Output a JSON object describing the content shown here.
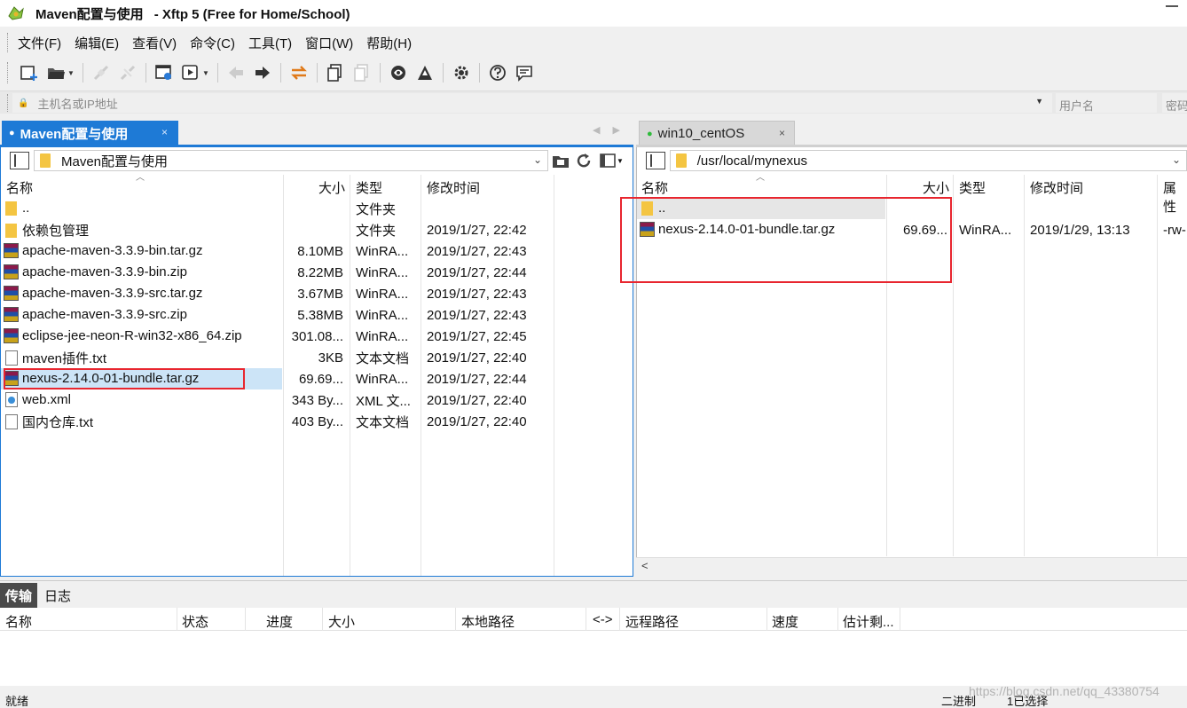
{
  "window": {
    "title_app": "Maven配置与使用",
    "title_suffix": "- Xftp 5 (Free for Home/School)"
  },
  "menu": [
    "文件(F)",
    "编辑(E)",
    "查看(V)",
    "命令(C)",
    "工具(T)",
    "窗口(W)",
    "帮助(H)"
  ],
  "toolbar": {
    "icons": [
      "new-session-icon",
      "open-folder-icon",
      "connect-icon",
      "disconnect-icon",
      "properties-icon",
      "transfer-icon",
      "back-arrow-icon",
      "forward-arrow-icon",
      "sync-icon",
      "copy-icon",
      "paste-icon",
      "xshell-icon",
      "xmanager-icon",
      "settings-icon",
      "help-icon",
      "chat-icon"
    ]
  },
  "address": {
    "host_placeholder": "主机名或IP地址",
    "user_placeholder": "用户名",
    "password_placeholder": "密码"
  },
  "left": {
    "tab_label": "Maven配置与使用",
    "path": "Maven配置与使用",
    "headers": {
      "name": "名称",
      "size": "大小",
      "type": "类型",
      "modified": "修改时间"
    },
    "files": [
      {
        "icon": "folder",
        "name": "..",
        "size": "",
        "type": "文件夹",
        "modified": ""
      },
      {
        "icon": "folder",
        "name": "依赖包管理",
        "size": "",
        "type": "文件夹",
        "modified": "2019/1/27, 22:42"
      },
      {
        "icon": "rar",
        "name": "apache-maven-3.3.9-bin.tar.gz",
        "size": "8.10MB",
        "type": "WinRA...",
        "modified": "2019/1/27, 22:43"
      },
      {
        "icon": "rar",
        "name": "apache-maven-3.3.9-bin.zip",
        "size": "8.22MB",
        "type": "WinRA...",
        "modified": "2019/1/27, 22:44"
      },
      {
        "icon": "rar",
        "name": "apache-maven-3.3.9-src.tar.gz",
        "size": "3.67MB",
        "type": "WinRA...",
        "modified": "2019/1/27, 22:43"
      },
      {
        "icon": "rar",
        "name": "apache-maven-3.3.9-src.zip",
        "size": "5.38MB",
        "type": "WinRA...",
        "modified": "2019/1/27, 22:43"
      },
      {
        "icon": "rar",
        "name": "eclipse-jee-neon-R-win32-x86_64.zip",
        "size": "301.08...",
        "type": "WinRA...",
        "modified": "2019/1/27, 22:45"
      },
      {
        "icon": "txt",
        "name": "maven插件.txt",
        "size": "3KB",
        "type": "文本文档",
        "modified": "2019/1/27, 22:40"
      },
      {
        "icon": "rar",
        "name": "nexus-2.14.0-01-bundle.tar.gz",
        "size": "69.69...",
        "type": "WinRA...",
        "modified": "2019/1/27, 22:44"
      },
      {
        "icon": "xml",
        "name": "web.xml",
        "size": "343 By...",
        "type": "XML 文...",
        "modified": "2019/1/27, 22:40"
      },
      {
        "icon": "txt",
        "name": "国内仓库.txt",
        "size": "403 By...",
        "type": "文本文档",
        "modified": "2019/1/27, 22:40"
      }
    ],
    "selected_index": 8
  },
  "right": {
    "tab_label": "win10_centOS",
    "path": "/usr/local/mynexus",
    "headers": {
      "name": "名称",
      "size": "大小",
      "type": "类型",
      "modified": "修改时间",
      "attr": "属性"
    },
    "files": [
      {
        "icon": "folder",
        "name": "..",
        "size": "",
        "type": "",
        "modified": "",
        "attr": ""
      },
      {
        "icon": "rar",
        "name": "nexus-2.14.0-01-bundle.tar.gz",
        "size": "69.69...",
        "type": "WinRA...",
        "modified": "2019/1/29, 13:13",
        "attr": "-rw-"
      }
    ]
  },
  "transfer": {
    "tabs": [
      "传输",
      "日志"
    ],
    "headers": [
      "名称",
      "状态",
      "进度",
      "大小",
      "本地路径",
      "<->",
      "远程路径",
      "速度",
      "估计剩..."
    ]
  },
  "status": {
    "left": "就绪",
    "mode": "二进制",
    "selection": "1已选择"
  },
  "watermark": "https://blog.csdn.net/qq_43380754",
  "colors": {
    "accent": "#1e7ad6",
    "highlight_box": "#e8262f",
    "selected_row": "#cce4f7",
    "connected_dot": "#2dbb3a"
  }
}
